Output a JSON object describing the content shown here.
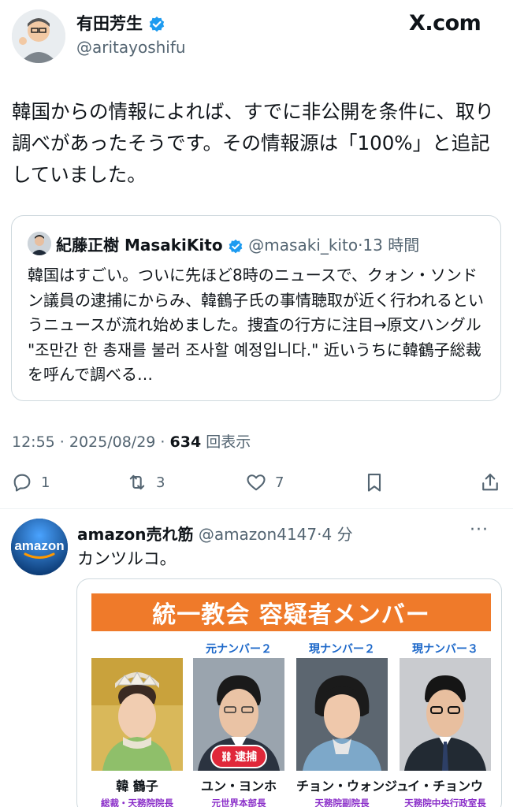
{
  "header": {
    "name": "有田芳生",
    "handle": "@aritayoshifu",
    "site_logo": "X.com"
  },
  "tweet": {
    "text": "韓国からの情報によれば、すでに非公開を条件に、取り調べがあったそうです。その情報源は「100%」と追記していました。"
  },
  "quote": {
    "name": "紀藤正樹 MasakiKito",
    "handle": "@masaki_kito",
    "time": "·13 時間",
    "text": "韓国はすごい。ついに先ほど8時のニュースで、クォン・ソンドン議員の逮捕にからみ、韓鶴子氏の事情聴取が近く行われるというニュースが流れ始めました。捜査の行方に注目→原文ハングル \"조만간 한 총재를 불러 조사할 예정입니다.\" 近いうちに韓鶴子総裁を呼んで調べる…"
  },
  "meta": {
    "time": "12:55 · 2025/08/29 · ",
    "views": "634",
    "views_label": " 回表示"
  },
  "actions": {
    "reply_count": "1",
    "retweet_count": "3",
    "like_count": "7"
  },
  "reply": {
    "name": "amazon売れ筋",
    "handle": "@amazon4147",
    "time": "·4 分",
    "text": "カンツルコ。",
    "avatar_text": "amazon",
    "more": "···"
  },
  "media": {
    "banner": "統一教会 容疑者メンバー",
    "members": [
      {
        "rank": "",
        "name": "韓 鶴子",
        "title": "総裁・天務院院長"
      },
      {
        "rank": "元ナンバー２",
        "name": "ユン・ヨンホ",
        "title": "元世界本部長",
        "badge": "逮捕"
      },
      {
        "rank": "現ナンバー２",
        "name": "チョン・ウォンジュ",
        "title": "天務院副院長"
      },
      {
        "rank": "現ナンバー３",
        "name": "イ・チョンウ",
        "title": "天務院中央行政室長"
      }
    ]
  },
  "colors": {
    "accent": "#1d9bf0",
    "muted": "#536471",
    "banner": "#ef7a2a",
    "rank": "#1b67c9",
    "title": "#8b2fc9",
    "arrest": "#e0283a"
  }
}
